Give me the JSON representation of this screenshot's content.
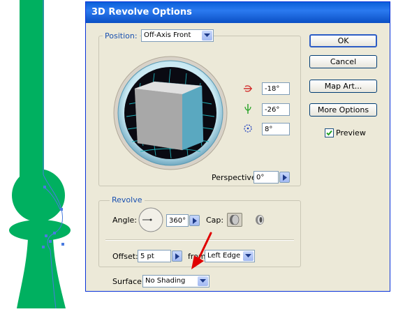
{
  "dialog": {
    "title": "3D Revolve Options",
    "position_label": "Position:",
    "position_value": "Off-Axis Front",
    "rotation_x": "-18°",
    "rotation_y": "-26°",
    "rotation_z": "8°",
    "perspective_label": "Perspective:",
    "perspective_value": "0°",
    "revolve_label": "Revolve",
    "angle_label": "Angle:",
    "angle_value": "360°",
    "cap_label": "Cap:",
    "offset_label": "Offset:",
    "offset_value": "5 pt",
    "from_label": "from",
    "from_value": "Left Edge",
    "surface_label": "Surface:",
    "surface_value": "No Shading"
  },
  "buttons": {
    "ok": "OK",
    "cancel": "Cancel",
    "map_art": "Map Art...",
    "more_options": "More Options"
  },
  "preview": {
    "label": "Preview",
    "checked": true
  },
  "icons": {
    "x_axis": "x-axis-rotation-icon",
    "y_axis": "y-axis-rotation-icon",
    "z_axis": "z-axis-rotation-icon",
    "cap_on": "cap-on-icon",
    "cap_off": "cap-off-icon",
    "annotation": "red-arrow-icon"
  },
  "colors": {
    "artwork": "#00b060",
    "path": "#4a7be0",
    "cube_front": "#5aa8c0",
    "cube_side": "#a8a8a8",
    "titlebar": "#0a5fd8",
    "annotation_arrow": "#e00000"
  }
}
